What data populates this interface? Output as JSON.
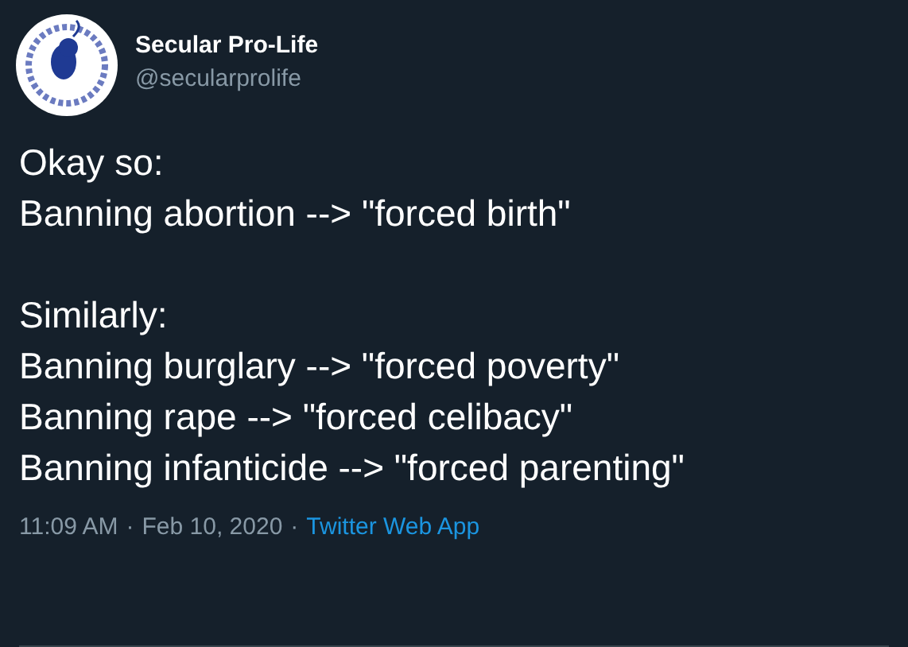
{
  "author": {
    "name": "Secular Pro-Life",
    "handle": "@secularprolife"
  },
  "tweet_text": "Okay so:\nBanning abortion --> \"forced birth\"\n\nSimilarly:\nBanning burglary --> \"forced poverty\"\nBanning rape --> \"forced celibacy\"\nBanning infanticide --> \"forced parenting\"",
  "meta": {
    "time": "11:09 AM",
    "separator_1": "·",
    "date": "Feb 10, 2020",
    "separator_2": "·",
    "source": "Twitter Web App"
  }
}
